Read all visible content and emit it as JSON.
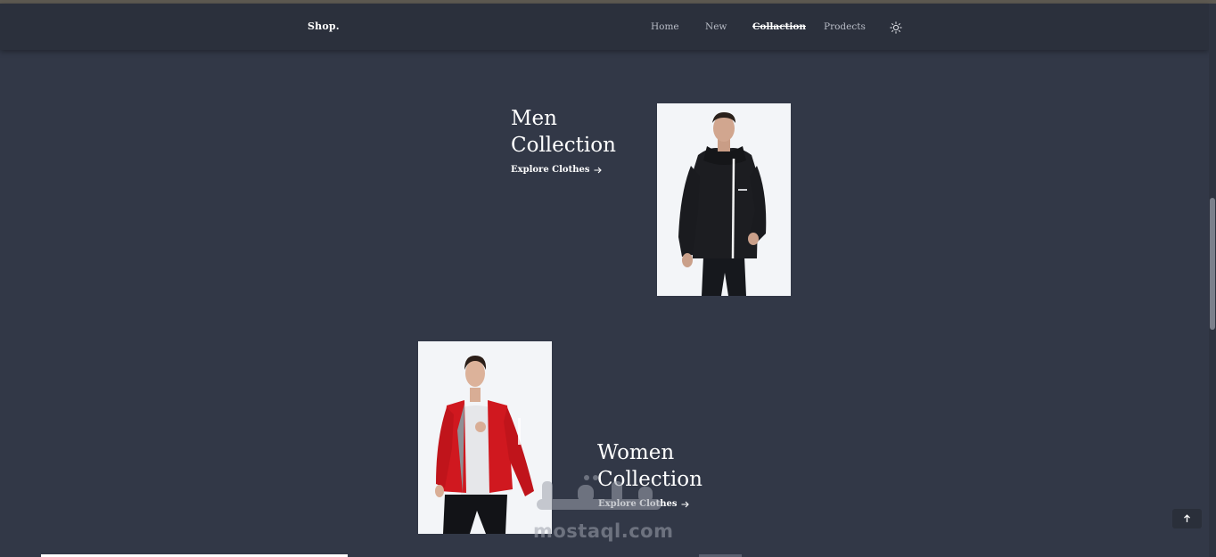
{
  "header": {
    "logo": "Shop.",
    "nav": [
      {
        "label": "Home",
        "active": false
      },
      {
        "label": "New",
        "active": false
      },
      {
        "label": "Collaction",
        "active": true
      },
      {
        "label": "Prodects",
        "active": false
      }
    ],
    "theme_icon": "sun-icon"
  },
  "sections": [
    {
      "title_line1": "Men",
      "title_line2": "Collection",
      "link": "Explore Clothes",
      "image": "man-black-jacket"
    },
    {
      "title_line1": "Women",
      "title_line2": "Collection",
      "link": "Explore Clothes",
      "image": "woman-red-jacket"
    }
  ],
  "watermark": {
    "text": "mostaql.com",
    "logo": "مستقل"
  },
  "back_to_top_icon": "arrow-up-icon",
  "colors": {
    "background": "#323847",
    "navbar": "#2b303c",
    "text": "#ffffff",
    "nav_inactive": "#b8bcc6",
    "photo_bg": "#f3f5f8",
    "women_jacket": "#d0181f"
  }
}
